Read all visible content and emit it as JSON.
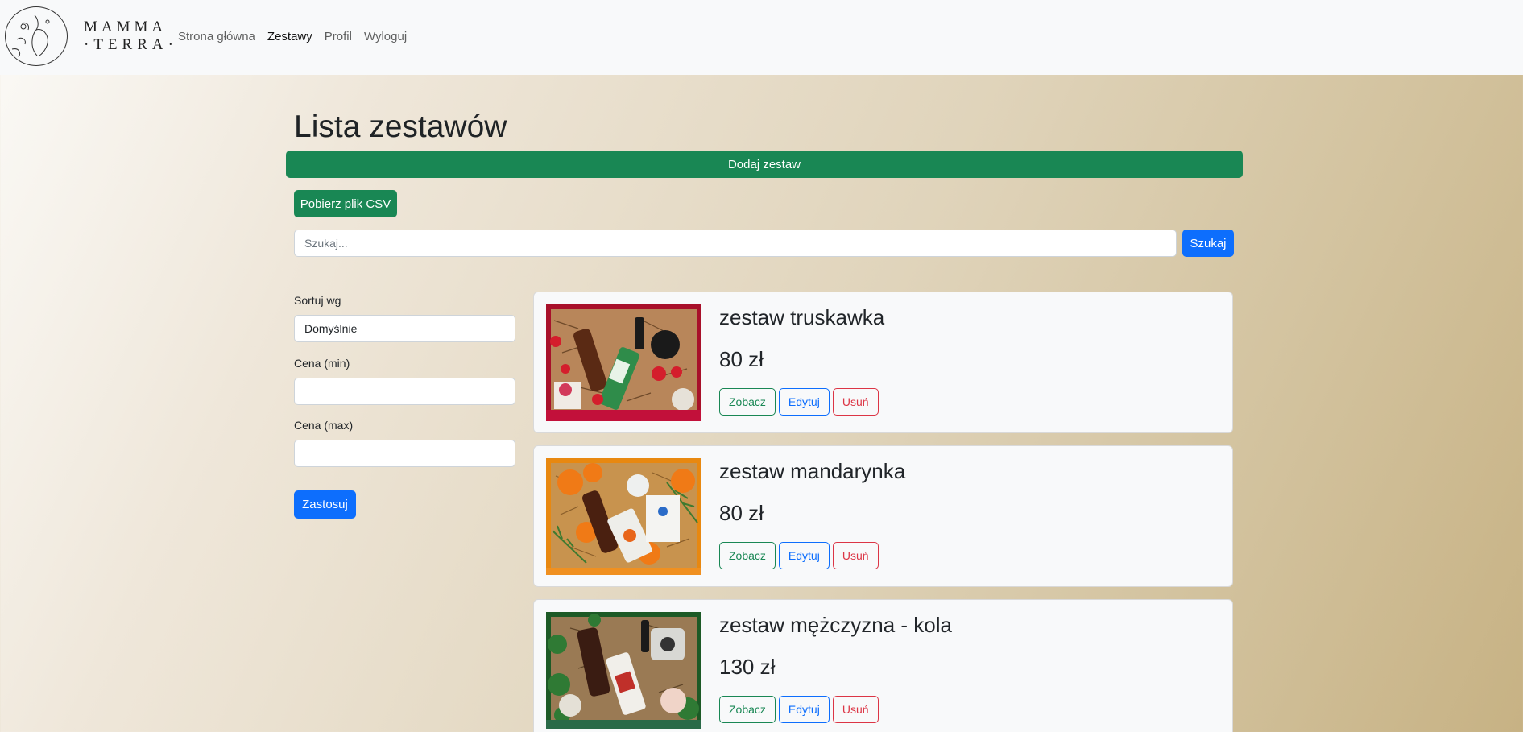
{
  "navbar": {
    "logo_lines": [
      "MAMMA",
      "·TERRA·"
    ],
    "links": [
      {
        "label": "Strona główna",
        "active": false
      },
      {
        "label": "Zestawy",
        "active": true
      },
      {
        "label": "Profil",
        "active": false
      },
      {
        "label": "Wyloguj",
        "active": false
      }
    ]
  },
  "main": {
    "title": "Lista zestawów",
    "add_button": "Dodaj zestaw",
    "csv_button": "Pobierz plik CSV",
    "search": {
      "placeholder": "Szukaj...",
      "button": "Szukaj"
    }
  },
  "filters": {
    "sort_label": "Sortuj wg",
    "sort_value": "Domyślnie",
    "min_label": "Cena (min)",
    "min_value": "",
    "max_label": "Cena (max)",
    "max_value": "",
    "apply_button": "Zastosuj"
  },
  "sets": [
    {
      "name": "zestaw truskawka",
      "price": "80 zł",
      "view": "Zobacz",
      "edit": "Edytuj",
      "delete": "Usuń",
      "theme": "#b3122a"
    },
    {
      "name": "zestaw mandarynka",
      "price": "80 zł",
      "view": "Zobacz",
      "edit": "Edytuj",
      "delete": "Usuń",
      "theme": "#e8890e"
    },
    {
      "name": "zestaw mężczyzna - kola",
      "price": "130 zł",
      "view": "Zobacz",
      "edit": "Edytuj",
      "delete": "Usuń",
      "theme": "#1f5a2a"
    }
  ],
  "colors": {
    "success": "#198754",
    "primary": "#0d6efd",
    "danger": "#dc3545",
    "navbar": "#f8f9fa"
  }
}
